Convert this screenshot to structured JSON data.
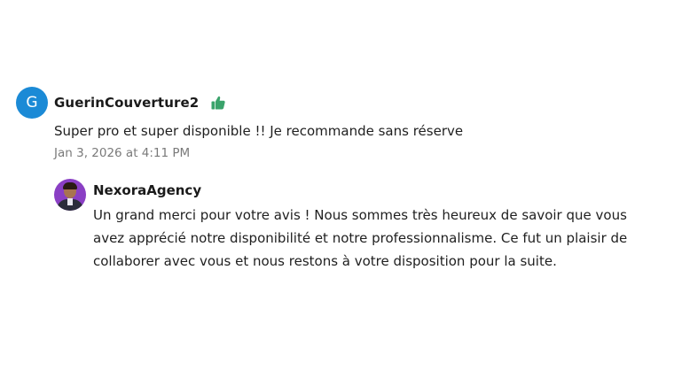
{
  "review": {
    "avatar_initial": "G",
    "author": "GuerinCouverture2",
    "text": "Super pro et super disponible !! Je recommande sans réserve",
    "date": "Jan 3, 2026 at 4:11 PM"
  },
  "reply": {
    "author": "NexoraAgency",
    "text_lines": [
      "Un grand merci pour votre avis ! Nous sommes très heureux de savoir que vous",
      "avez apprécié notre disponibilité et notre professionnalisme. Ce fut un plaisir de",
      "collaborer avec vous et nous restons à votre disposition pour la suite."
    ]
  },
  "icons": {
    "thumb": "thumbs-up-icon",
    "reply_avatar": "avatar-photo"
  },
  "colors": {
    "avatar_blue": "#1b8ad6",
    "thumb_green": "#3aa36b",
    "reply_avatar_bg": "#8a3fc4",
    "date_gray": "#7a7a7a"
  }
}
